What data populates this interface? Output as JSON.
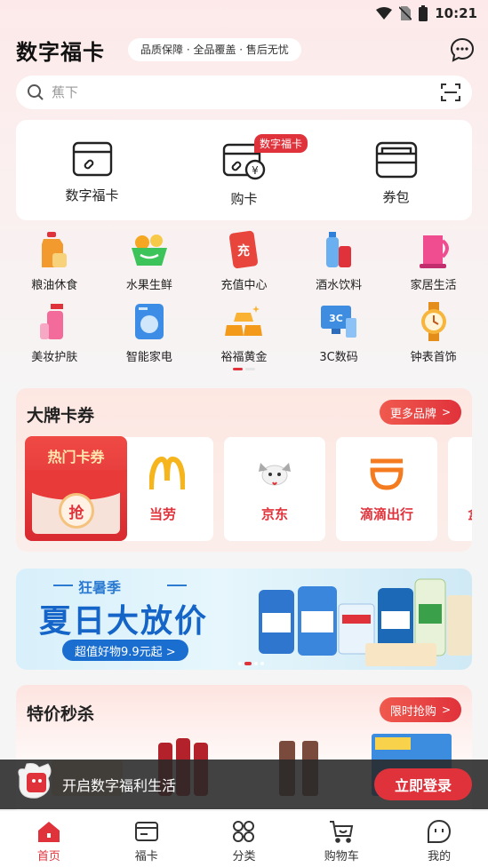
{
  "status_bar": {
    "time": "10:21"
  },
  "header": {
    "title": "数字福卡",
    "slogan": "品质保障 · 全品覆盖 · 售后无忧"
  },
  "search": {
    "placeholder": "蕉下"
  },
  "main_card": {
    "items": [
      {
        "label": "数字福卡"
      },
      {
        "label": "购卡",
        "badge": "数字福卡"
      },
      {
        "label": "券包"
      }
    ]
  },
  "categories": [
    {
      "label": "粮油休食",
      "icon": "oil-bottle-icon"
    },
    {
      "label": "水果生鲜",
      "icon": "fruit-basket-icon"
    },
    {
      "label": "充值中心",
      "icon": "recharge-phone-icon"
    },
    {
      "label": "酒水饮料",
      "icon": "drink-bottle-icon"
    },
    {
      "label": "家居生活",
      "icon": "kettle-icon"
    },
    {
      "label": "美妆护肤",
      "icon": "cosmetics-icon"
    },
    {
      "label": "智能家电",
      "icon": "washing-machine-icon"
    },
    {
      "label": "裕福黄金",
      "icon": "gold-bars-icon"
    },
    {
      "label": "3C数码",
      "icon": "computer-icon"
    },
    {
      "label": "钟表首饰",
      "icon": "watch-icon"
    }
  ],
  "brand_section": {
    "title": "大牌卡券",
    "more_label": "更多品牌",
    "hot_card": {
      "title": "热门卡券",
      "coin": "抢"
    },
    "brands": [
      {
        "name": "当劳",
        "logo": "mcdonalds-logo"
      },
      {
        "name": "京东",
        "logo": "jd-dog-logo"
      },
      {
        "name": "滴滴出行",
        "logo": "didi-logo"
      },
      {
        "name": "盒",
        "logo": "partial-logo"
      }
    ]
  },
  "banner": {
    "season": "狂暑季",
    "title": "夏日大放价",
    "cta": "超值好物9.9元起 >"
  },
  "flash_section": {
    "title": "特价秒杀",
    "more_label": "限时抢购"
  },
  "login_bar": {
    "text": "开启数字福利生活",
    "button": "立即登录"
  },
  "tabs": [
    {
      "label": "首页",
      "active": true
    },
    {
      "label": "福卡"
    },
    {
      "label": "分类"
    },
    {
      "label": "购物车"
    },
    {
      "label": "我的"
    }
  ],
  "colors": {
    "accent": "#e0323b",
    "banner_blue": "#1565c8"
  }
}
